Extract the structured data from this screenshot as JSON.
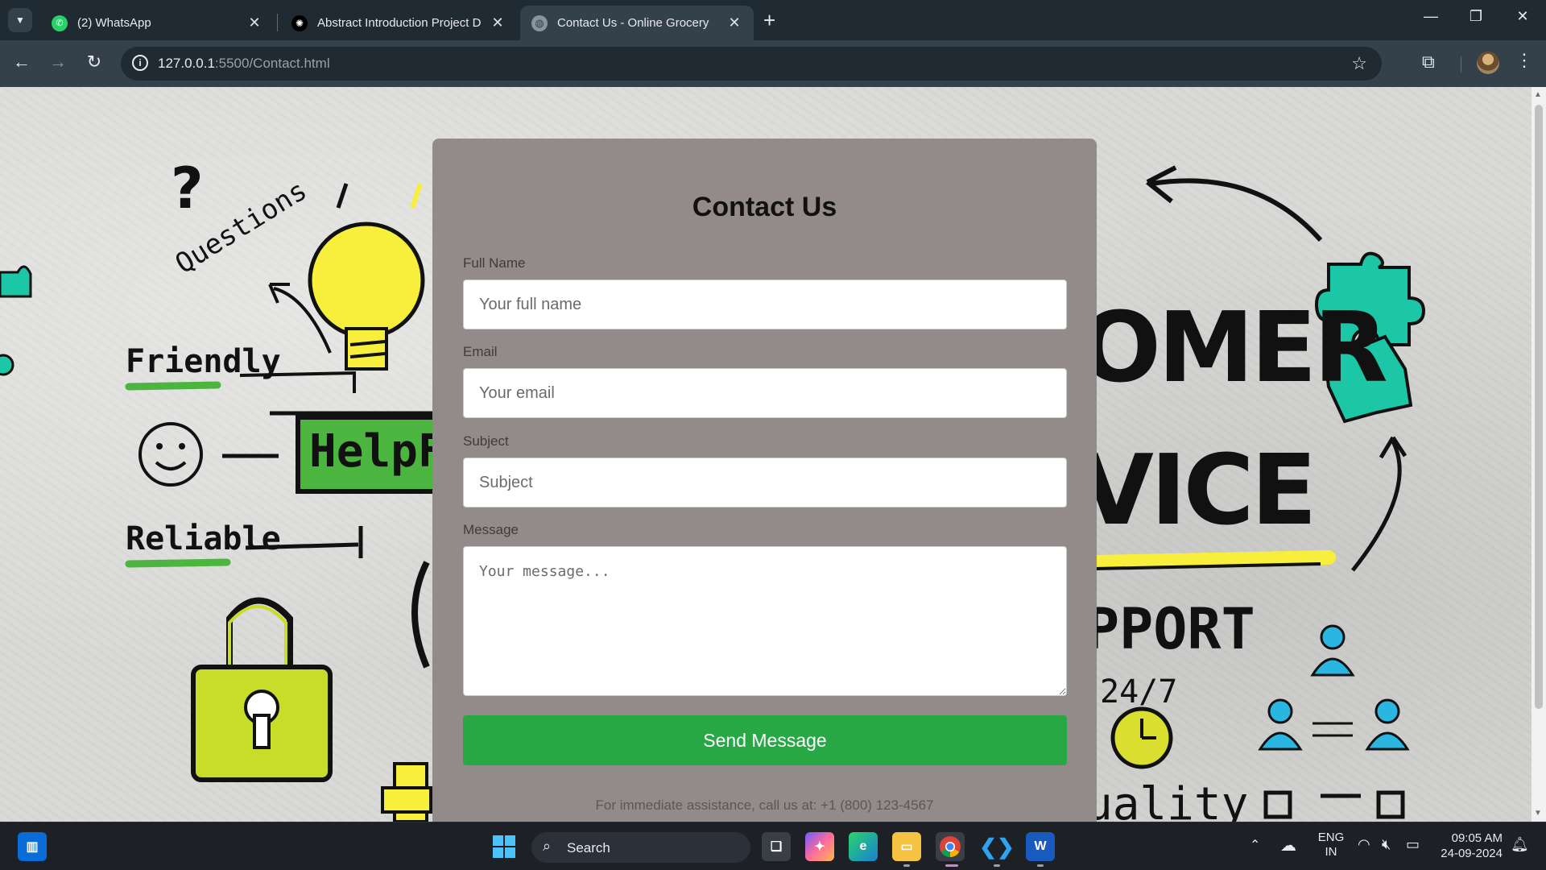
{
  "browser": {
    "tabs": [
      {
        "title": "(2) WhatsApp",
        "favicon": "whatsapp-icon"
      },
      {
        "title": "Abstract Introduction Project D",
        "favicon": "chatgpt-icon"
      },
      {
        "title": "Contact Us - Online Grocery",
        "favicon": "globe-icon",
        "active": true
      }
    ],
    "url_host": "127.0.0.1",
    "url_path": ":5500/Contact.html"
  },
  "background": {
    "words": [
      "Questions",
      "Friendly",
      "HelpFu",
      "Reliable",
      "OMER",
      "VICE",
      "PPORT",
      "24/7",
      "uality"
    ]
  },
  "form": {
    "title": "Contact Us",
    "fields": {
      "name": {
        "label": "Full Name",
        "placeholder": "Your full name"
      },
      "email": {
        "label": "Email",
        "placeholder": "Your email"
      },
      "subject": {
        "label": "Subject",
        "placeholder": "Subject"
      },
      "message": {
        "label": "Message",
        "placeholder": "Your message..."
      }
    },
    "submit_label": "Send Message",
    "assistance_note": "For immediate assistance, call us at: +1 (800) 123-4567",
    "accent_color": "#28a745"
  },
  "taskbar": {
    "search_label": "Search",
    "language": "ENG",
    "region": "IN",
    "time": "09:05 AM",
    "date": "24-09-2024"
  }
}
